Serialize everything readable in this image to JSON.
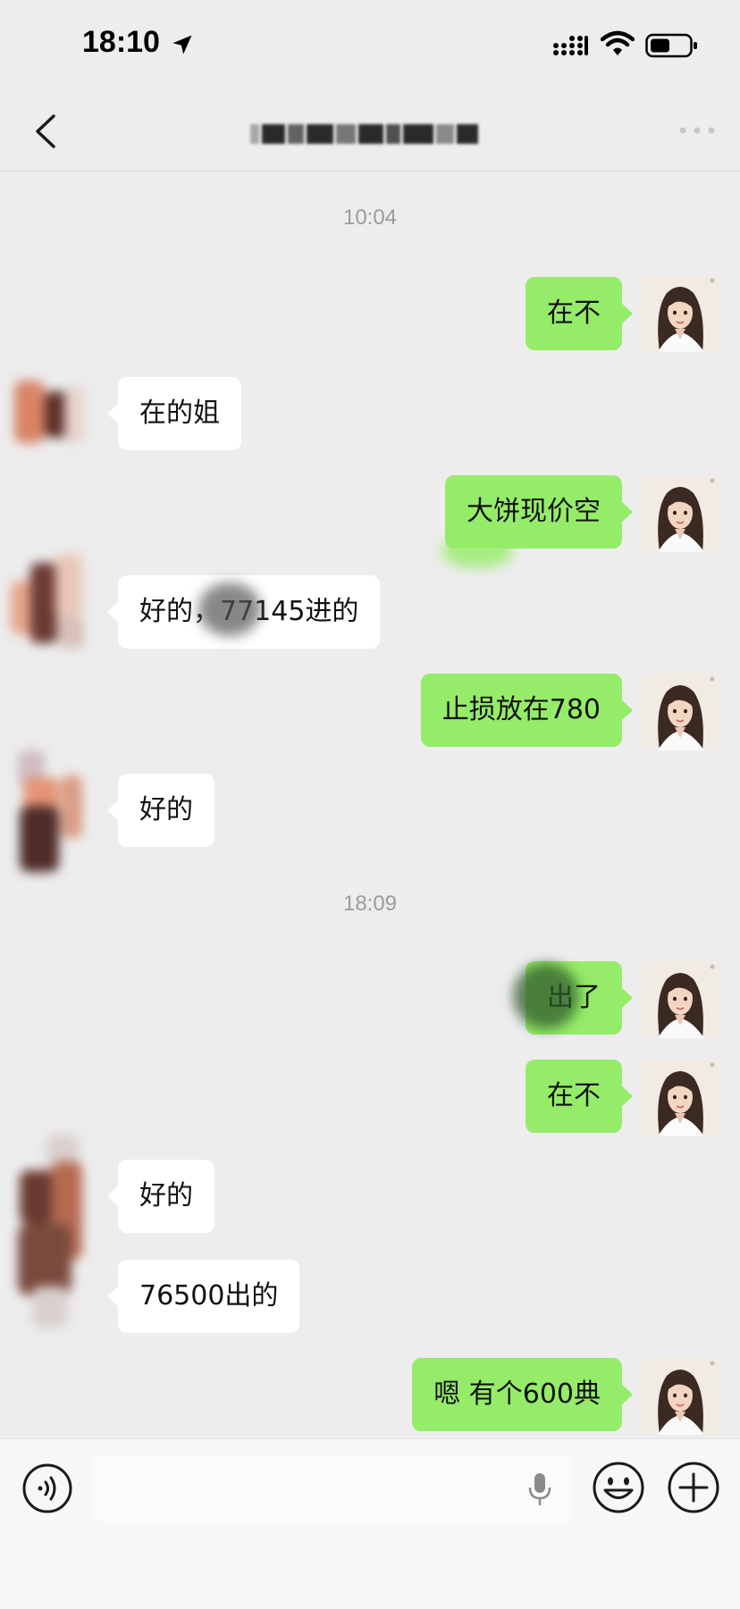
{
  "status_bar": {
    "time": "18:10"
  },
  "chat": {
    "title": ""
  },
  "timestamps": [
    "10:04",
    "18:09"
  ],
  "messages": [
    {
      "side": "right",
      "text": "在不"
    },
    {
      "side": "left",
      "text": "在的姐"
    },
    {
      "side": "right",
      "text": "大饼现价空"
    },
    {
      "side": "left",
      "text": "好的，77145进的"
    },
    {
      "side": "right",
      "text": "止损放在780"
    },
    {
      "side": "left",
      "text": "好的"
    },
    {
      "side": "right",
      "text": "出了"
    },
    {
      "side": "right",
      "text": "在不"
    },
    {
      "side": "left",
      "text": "好的"
    },
    {
      "side": "left",
      "text": "76500出的"
    },
    {
      "side": "right",
      "text": "嗯 有个600典"
    }
  ],
  "input": {
    "value": "",
    "placeholder": ""
  },
  "colors": {
    "bubble_self": "#95ec69",
    "bubble_other": "#ffffff",
    "background": "#ededed"
  },
  "icons": [
    "location-arrow-icon",
    "signal-icon",
    "wifi-icon",
    "battery-icon",
    "back-icon",
    "more-icon",
    "voice-icon",
    "mic-icon",
    "emoji-icon",
    "plus-icon"
  ]
}
